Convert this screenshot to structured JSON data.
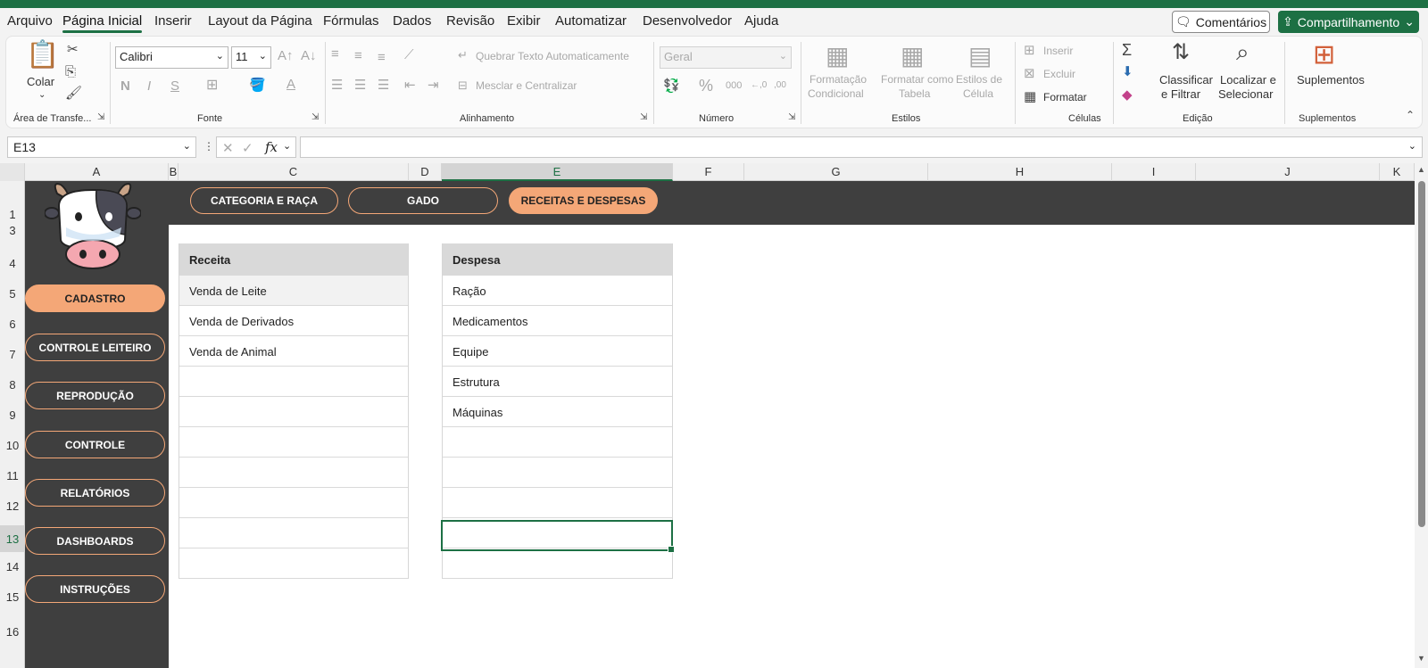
{
  "menu": [
    "Arquivo",
    "Página Inicial",
    "Inserir",
    "Layout da Página",
    "Fórmulas",
    "Dados",
    "Revisão",
    "Exibir",
    "Automatizar",
    "Desenvolvedor",
    "Ajuda"
  ],
  "menu_active": "Página Inicial",
  "comments_label": "Comentários",
  "share_label": "Compartilhamento",
  "ribbon": {
    "clipboard": {
      "paste_label": "Colar",
      "group_label": "Área de Transfe..."
    },
    "font": {
      "font_name": "Calibri",
      "font_size": "11",
      "group_label": "Fonte",
      "bold": "N",
      "italic": "I",
      "underline": "S",
      "font_color": "A"
    },
    "alignment": {
      "wrap_label": "Quebrar Texto Automaticamente",
      "merge_label": "Mesclar e Centralizar",
      "group_label": "Alinhamento"
    },
    "number": {
      "format": "Geral",
      "percent": "%",
      "thousands": "000",
      "dec_inc": "←,0",
      "dec_dec": ",00",
      "group_label": "Número"
    },
    "styles": {
      "cond_format_1": "Formatação",
      "cond_format_2": "Condicional",
      "format_table_1": "Formatar como",
      "format_table_2": "Tabela",
      "cell_styles_1": "Estilos de",
      "cell_styles_2": "Célula",
      "group_label": "Estilos"
    },
    "cells": {
      "insert_label": "Inserir",
      "delete_label": "Excluir",
      "format_label": "Formatar",
      "group_label": "Células"
    },
    "editing": {
      "sort_1": "Classificar",
      "sort_2": "e Filtrar",
      "find_1": "Localizar e",
      "find_2": "Selecionar",
      "group_label": "Edição"
    },
    "addins": {
      "label": "Suplementos",
      "group_label": "Suplementos"
    }
  },
  "name_box": "E13",
  "fx_label": "fx",
  "columns": [
    "A",
    "B",
    "C",
    "D",
    "E",
    "F",
    "G",
    "H",
    "I",
    "J",
    "K"
  ],
  "rows": [
    "1",
    "3",
    "4",
    "5",
    "6",
    "7",
    "8",
    "9",
    "10",
    "11",
    "12",
    "13",
    "14",
    "15",
    "16"
  ],
  "selected_column": "E",
  "selected_row": "13",
  "nav_tabs": [
    {
      "label": "CATEGORIA E RAÇA",
      "active": false
    },
    {
      "label": "GADO",
      "active": false
    },
    {
      "label": "RECEITAS E DESPESAS",
      "active": true
    }
  ],
  "side_buttons": [
    {
      "label": "CADASTRO",
      "active": true
    },
    {
      "label": "CONTROLE LEITEIRO",
      "active": false
    },
    {
      "label": "REPRODUÇÃO",
      "active": false
    },
    {
      "label": "CONTROLE",
      "active": false
    },
    {
      "label": "RELATÓRIOS",
      "active": false
    },
    {
      "label": "DASHBOARDS",
      "active": false
    },
    {
      "label": "INSTRUÇÕES",
      "active": false
    }
  ],
  "receita": {
    "header": "Receita",
    "items": [
      "Venda de Leite",
      "Venda de Derivados",
      "Venda de Animal",
      "",
      "",
      "",
      "",
      "",
      "",
      ""
    ]
  },
  "despesa": {
    "header": "Despesa",
    "items": [
      "Ração",
      "Medicamentos",
      "Equipe",
      "Estrutura",
      "Máquinas",
      "",
      "",
      "",
      "",
      ""
    ]
  },
  "colors": {
    "accent_green": "#1d7044",
    "dark_panel": "#3f3f3f",
    "orange": "#f4a777"
  }
}
